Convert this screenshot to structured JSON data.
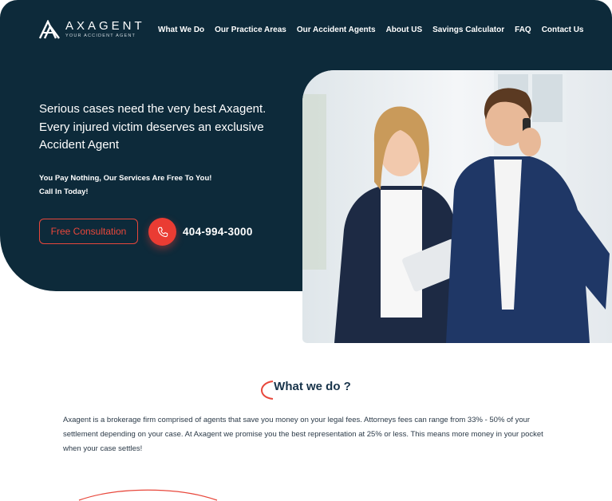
{
  "brand": {
    "name": "AXAGENT",
    "tagline": "YOUR ACCIDENT AGENT"
  },
  "nav": {
    "items": [
      {
        "label": "What We Do"
      },
      {
        "label": "Our Practice Areas"
      },
      {
        "label": "Our Accident Agents"
      },
      {
        "label": "About US"
      },
      {
        "label": "Savings Calculator"
      },
      {
        "label": "FAQ"
      },
      {
        "label": "Contact Us"
      }
    ]
  },
  "hero": {
    "headline": "Serious cases need the very best Axagent. Every injured victim deserves an exclusive Accident Agent",
    "sub_line1": "You Pay Nothing, Our Services Are Free To You!",
    "sub_line2": "Call In Today!",
    "cta_label": "Free Consultation",
    "phone_icon": "phone-icon",
    "phone_number": "404-994-3000"
  },
  "what_we_do": {
    "title": "What we do ?",
    "description": "Axagent is a brokerage firm comprised of agents that save you money on your legal fees. Attorneys fees can range from 33% - 50% of your settlement depending on your case. At Axagent we promise you the best representation at 25% or less. This means more money in your pocket when your case settles!"
  },
  "colors": {
    "navy": "#0d2a3a",
    "accent": "#e8473b",
    "title": "#17334a"
  }
}
